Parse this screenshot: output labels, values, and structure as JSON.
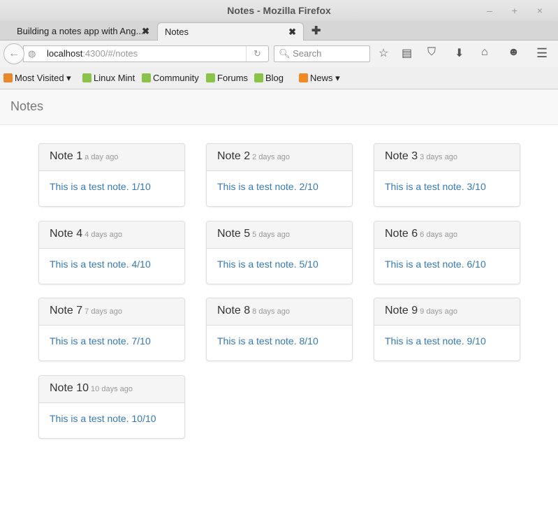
{
  "window": {
    "title": "Notes - Mozilla Firefox",
    "controls": "– + ×"
  },
  "tabs": [
    {
      "label": "Building a notes app with Ang..."
    },
    {
      "label": "Notes"
    }
  ],
  "nav": {
    "url_host": "localhost",
    "url_rest": ":4300/#/notes",
    "search_placeholder": "Search"
  },
  "bookmarks": [
    {
      "label": "Most Visited ▾",
      "color": "#e8882a"
    },
    {
      "label": "Linux Mint",
      "color": "#8bc34a"
    },
    {
      "label": "Community",
      "color": "#8bc34a"
    },
    {
      "label": "Forums",
      "color": "#8bc34a"
    },
    {
      "label": "Blog",
      "color": "#8bc34a"
    },
    {
      "label": "News ▾",
      "color": "#f08a24"
    }
  ],
  "app": {
    "brand": "Notes"
  },
  "notes": [
    {
      "title": "Note 1",
      "time": "a day ago",
      "body": "This is a test note. 1/10"
    },
    {
      "title": "Note 2",
      "time": "2 days ago",
      "body": "This is a test note. 2/10"
    },
    {
      "title": "Note 3",
      "time": "3 days ago",
      "body": "This is a test note. 3/10"
    },
    {
      "title": "Note 4",
      "time": "4 days ago",
      "body": "This is a test note. 4/10"
    },
    {
      "title": "Note 5",
      "time": "5 days ago",
      "body": "This is a test note. 5/10"
    },
    {
      "title": "Note 6",
      "time": "6 days ago",
      "body": "This is a test note. 6/10"
    },
    {
      "title": "Note 7",
      "time": "7 days ago",
      "body": "This is a test note. 7/10"
    },
    {
      "title": "Note 8",
      "time": "8 days ago",
      "body": "This is a test note. 8/10"
    },
    {
      "title": "Note 9",
      "time": "9 days ago",
      "body": "This is a test note. 9/10"
    },
    {
      "title": "Note 10",
      "time": "10 days ago",
      "body": "This is a test note. 10/10"
    }
  ]
}
